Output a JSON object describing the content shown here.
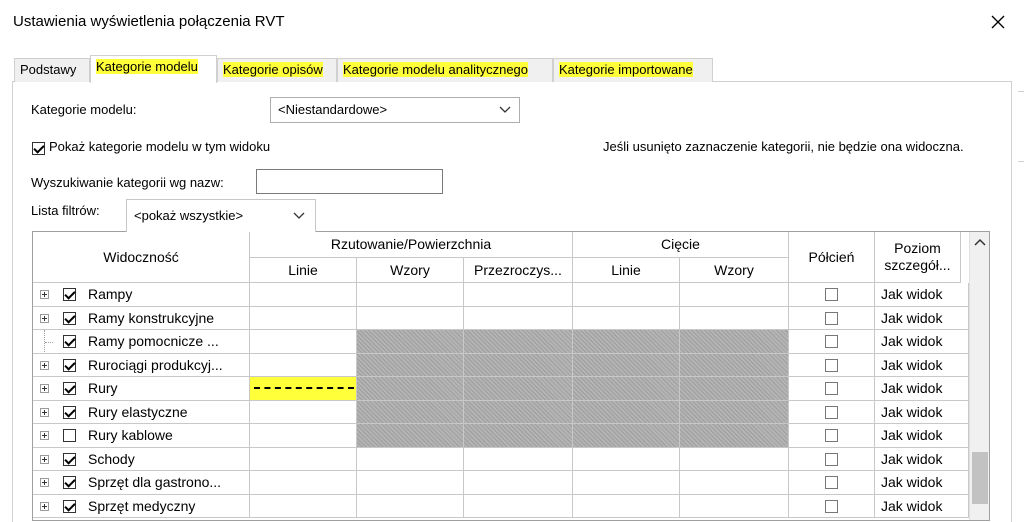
{
  "window": {
    "title": "Ustawienia wyświetlenia połączenia RVT",
    "close_glyph": "✕"
  },
  "tabs": [
    {
      "label": "Podstawy",
      "active": false,
      "highlighted": false
    },
    {
      "label": "Kategorie modelu",
      "active": true,
      "highlighted": true
    },
    {
      "label": "Kategorie opisów",
      "active": false,
      "highlighted": true
    },
    {
      "label": "Kategorie modelu analitycznego",
      "active": false,
      "highlighted": true
    },
    {
      "label": "Kategorie importowane",
      "active": false,
      "highlighted": true
    }
  ],
  "model_category": {
    "label": "Kategorie modelu:",
    "selected": "<Niestandardowe>"
  },
  "show_categories": {
    "label": "Pokaż kategorie modelu w tym widoku",
    "checked": true
  },
  "info_text": "Jeśli usunięto zaznaczenie kategorii, nie będzie ona widoczna.",
  "search": {
    "label": "Wyszukiwanie kategorii wg nazw:",
    "value": ""
  },
  "filter_list": {
    "label": "Lista filtrów:",
    "selected": "<pokaż wszystkie>"
  },
  "table": {
    "headers": {
      "visibility": "Widoczność",
      "projection_surface": "Rzutowanie/Powierzchnia",
      "lines": "Linie",
      "patterns": "Wzory",
      "transparency": "Przezroczys...",
      "cut": "Cięcie",
      "cut_lines": "Linie",
      "cut_patterns": "Wzory",
      "halftone": "Półcień",
      "detail_level": "Poziom szczegół..."
    },
    "rows": [
      {
        "name": "Rampy",
        "expandable": true,
        "checked": true,
        "hatched": false,
        "dashed": false,
        "detail": "Jak widok"
      },
      {
        "name": "Ramy konstrukcyjne",
        "expandable": true,
        "checked": true,
        "hatched": false,
        "dashed": false,
        "detail": "Jak widok"
      },
      {
        "name": "Ramy pomocnicze ...",
        "expandable": false,
        "checked": true,
        "hatched": true,
        "dashed": false,
        "detail": "Jak widok"
      },
      {
        "name": "Rurociągi produkcyj...",
        "expandable": true,
        "checked": true,
        "hatched": true,
        "dashed": false,
        "detail": "Jak widok"
      },
      {
        "name": "Rury",
        "expandable": true,
        "checked": true,
        "hatched": true,
        "dashed": true,
        "detail": "Jak widok"
      },
      {
        "name": "Rury elastyczne",
        "expandable": true,
        "checked": true,
        "hatched": true,
        "dashed": false,
        "detail": "Jak widok"
      },
      {
        "name": "Rury kablowe",
        "expandable": true,
        "checked": false,
        "hatched": true,
        "dashed": false,
        "detail": "Jak widok"
      },
      {
        "name": "Schody",
        "expandable": true,
        "checked": true,
        "hatched": false,
        "dashed": false,
        "detail": "Jak widok"
      },
      {
        "name": "Sprzęt dla gastrono...",
        "expandable": true,
        "checked": true,
        "hatched": false,
        "dashed": false,
        "detail": "Jak widok"
      },
      {
        "name": "Sprzęt medyczny",
        "expandable": true,
        "checked": true,
        "hatched": false,
        "dashed": false,
        "detail": "Jak widok"
      }
    ]
  },
  "colors": {
    "highlight": "#ffff3a",
    "hatch": "#aaaaaa",
    "border": "#c8c8c8"
  },
  "icons": {
    "close": "close-icon",
    "dropdown": "chevron-down-icon",
    "expand": "plus-box-icon",
    "scroll_up": "chevron-up-icon"
  }
}
